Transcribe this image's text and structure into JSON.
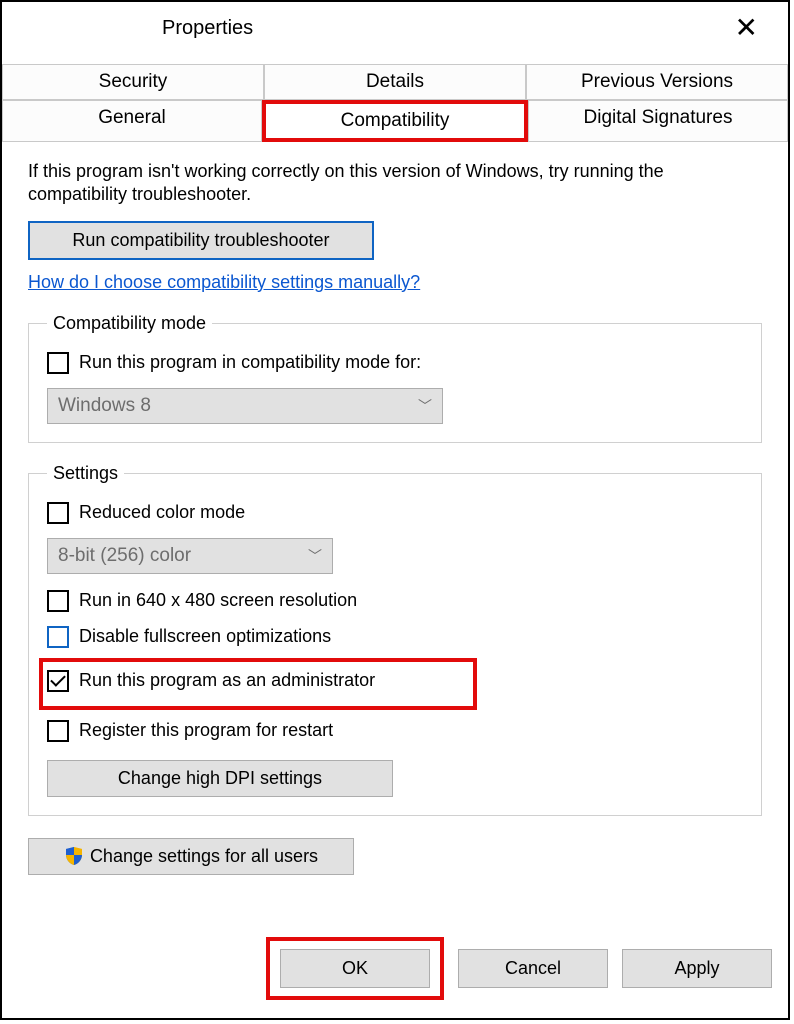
{
  "window": {
    "title": "Properties"
  },
  "tabs_top": {
    "security": "Security",
    "details": "Details",
    "previous_versions": "Previous Versions"
  },
  "tabs_bottom": {
    "general": "General",
    "compatibility": "Compatibility",
    "digital_signatures": "Digital Signatures"
  },
  "intro": "If this program isn't working correctly on this version of Windows, try running the compatibility troubleshooter.",
  "buttons": {
    "run_troubleshooter": "Run compatibility troubleshooter",
    "change_dpi": "Change high DPI settings",
    "change_all_users": "Change settings for all users",
    "ok": "OK",
    "cancel": "Cancel",
    "apply": "Apply"
  },
  "link_manual": "How do I choose compatibility settings manually?",
  "compat_mode": {
    "legend": "Compatibility mode",
    "check_label": "Run this program in compatibility mode for:",
    "dropdown_value": "Windows 8"
  },
  "settings": {
    "legend": "Settings",
    "reduced_color": "Reduced color mode",
    "color_dropdown": "8-bit (256) color",
    "run_640": "Run in 640 x 480 screen resolution",
    "disable_fullscreen": "Disable fullscreen optimizations",
    "run_admin": "Run this program as an administrator",
    "register_restart": "Register this program for restart"
  }
}
